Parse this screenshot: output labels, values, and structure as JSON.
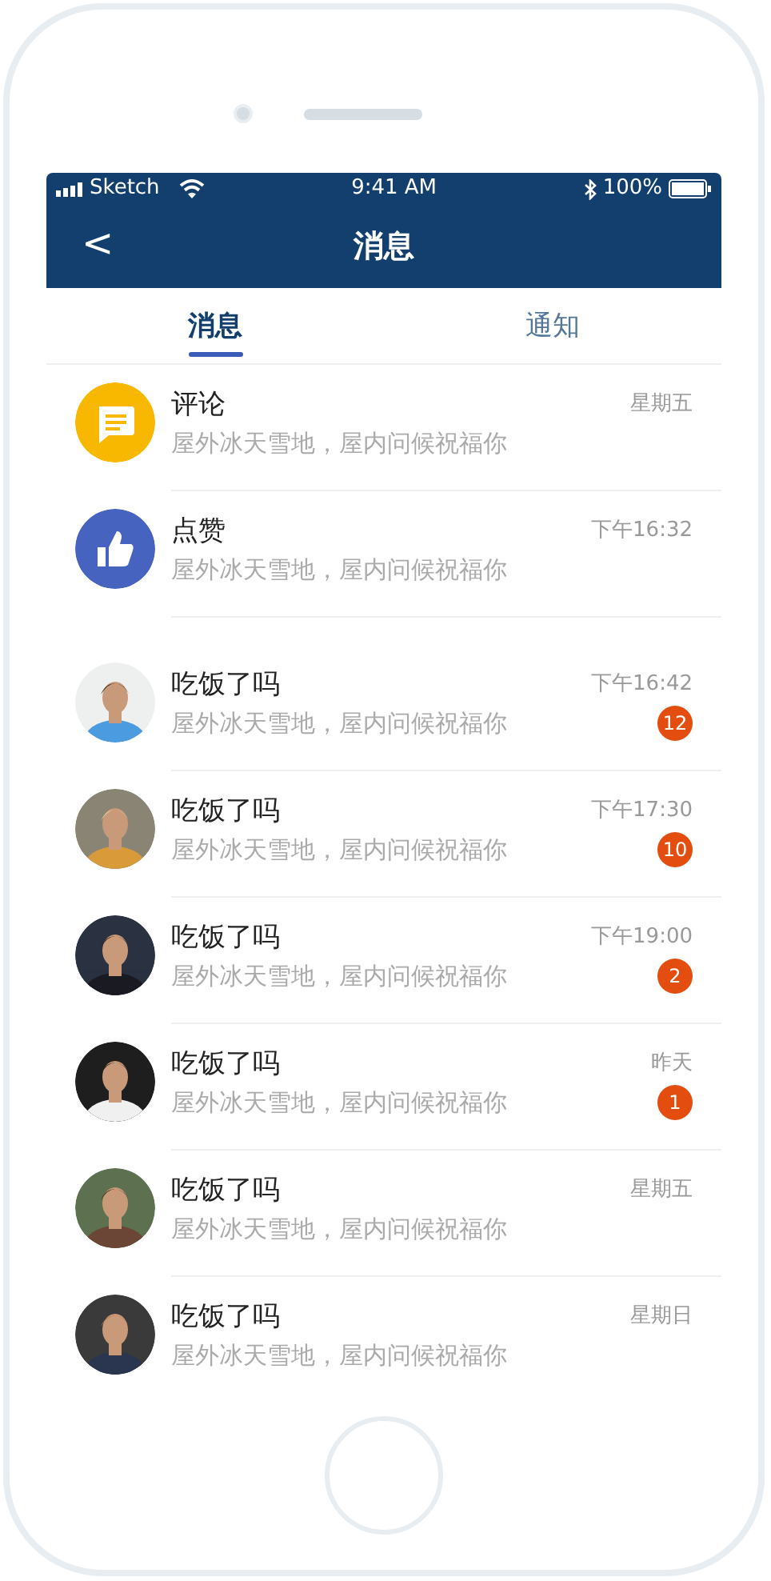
{
  "status_bar": {
    "carrier": "Sketch",
    "time": "9:41 AM",
    "battery": "100%"
  },
  "nav_bar": {
    "back": "<",
    "title": "消息"
  },
  "tabs": [
    {
      "label": "消息",
      "selected": true
    },
    {
      "label": "通知",
      "selected": false
    }
  ],
  "notifications": [
    {
      "kind": "comment",
      "title": "评论",
      "preview": "屋外冰天雪地，屋内问候祝福你",
      "time": "星期五"
    },
    {
      "kind": "like",
      "title": "点赞",
      "preview": "屋外冰天雪地，屋内问候祝福你",
      "time": "下午16:32"
    }
  ],
  "conversations": [
    {
      "kind": "picture",
      "title": "吃饭了吗",
      "preview": "屋外冰天雪地，屋内问候祝福你",
      "time": "下午16:42",
      "badge": "12"
    },
    {
      "kind": "picture",
      "title": "吃饭了吗",
      "preview": "屋外冰天雪地，屋内问候祝福你",
      "time": "下午17:30",
      "badge": "10"
    },
    {
      "kind": "picture",
      "title": "吃饭了吗",
      "preview": "屋外冰天雪地，屋内问候祝福你",
      "time": "下午19:00",
      "badge": "2"
    },
    {
      "kind": "picture",
      "title": "吃饭了吗",
      "preview": "屋外冰天雪地，屋内问候祝福你",
      "time": "昨天",
      "badge": "1"
    },
    {
      "kind": "picture",
      "title": "吃饭了吗",
      "preview": "屋外冰天雪地，屋内问候祝福你",
      "time": "星期五"
    },
    {
      "kind": "picture",
      "title": "吃饭了吗",
      "preview": "屋外冰天雪地，屋内问候祝福你",
      "time": "星期日"
    }
  ]
}
